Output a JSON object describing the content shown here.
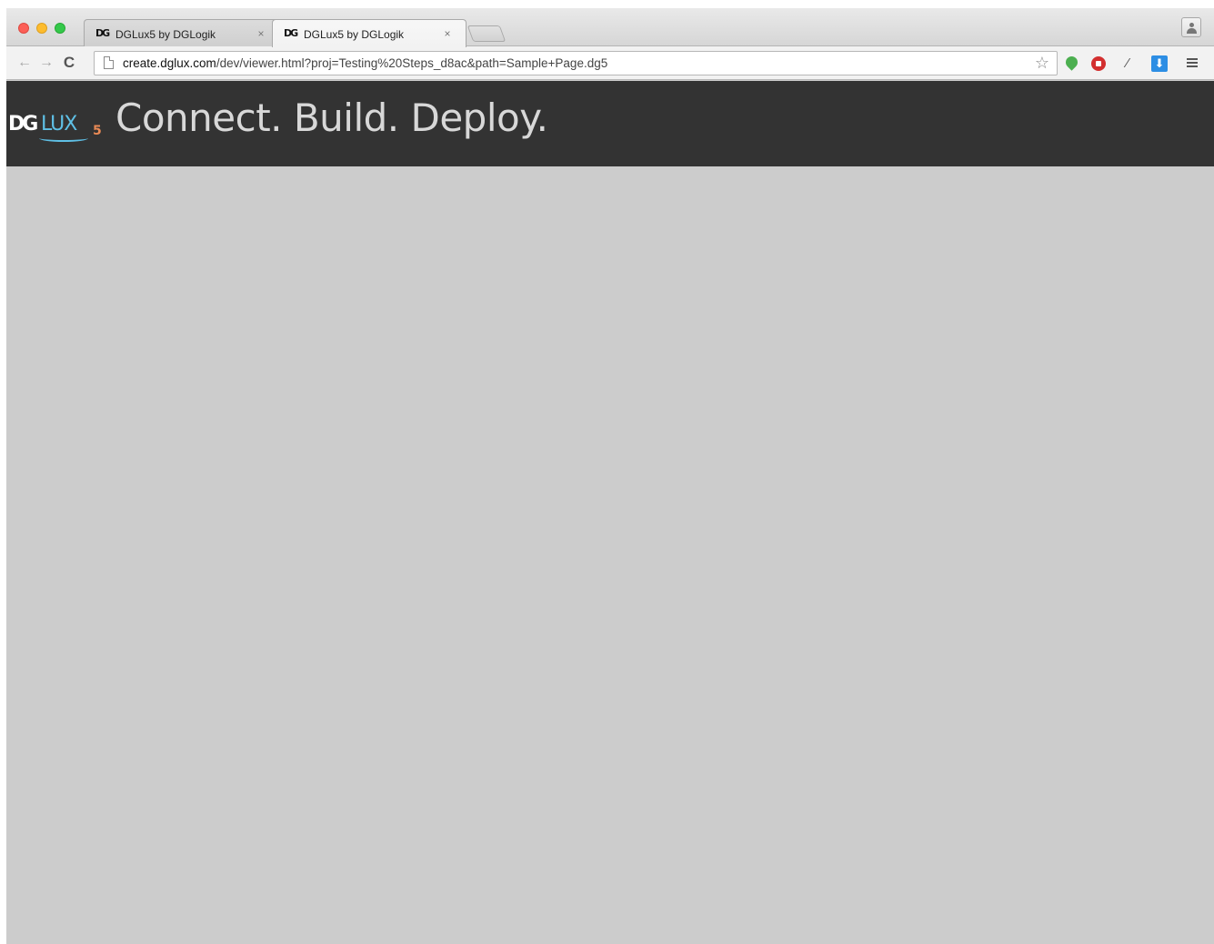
{
  "browser": {
    "tabs": [
      {
        "title": "DGLux5 by DGLogik",
        "favicon": "DG",
        "close": "×",
        "active": false
      },
      {
        "title": "DGLux5 by DGLogik",
        "favicon": "DG",
        "close": "×",
        "active": true
      }
    ],
    "toolbar": {
      "back_icon": "←",
      "forward_icon": "→",
      "reload_icon": "C",
      "url_host": "create.dglux.com",
      "url_path": "/dev/viewer.html?proj=Testing%20Steps_d8ac&path=Sample+Page.dg5",
      "bookmark_icon": "☆",
      "dropper_icon": "⁄"
    }
  },
  "app": {
    "logo": {
      "dg": "DG",
      "lux": "LUX",
      "five": "5"
    },
    "tagline": "Connect. Build. Deploy."
  },
  "colors": {
    "header_bg": "#333333",
    "page_bg": "#cccccc",
    "logo_blue": "#5fc0e6",
    "logo_orange": "#e98a55"
  }
}
